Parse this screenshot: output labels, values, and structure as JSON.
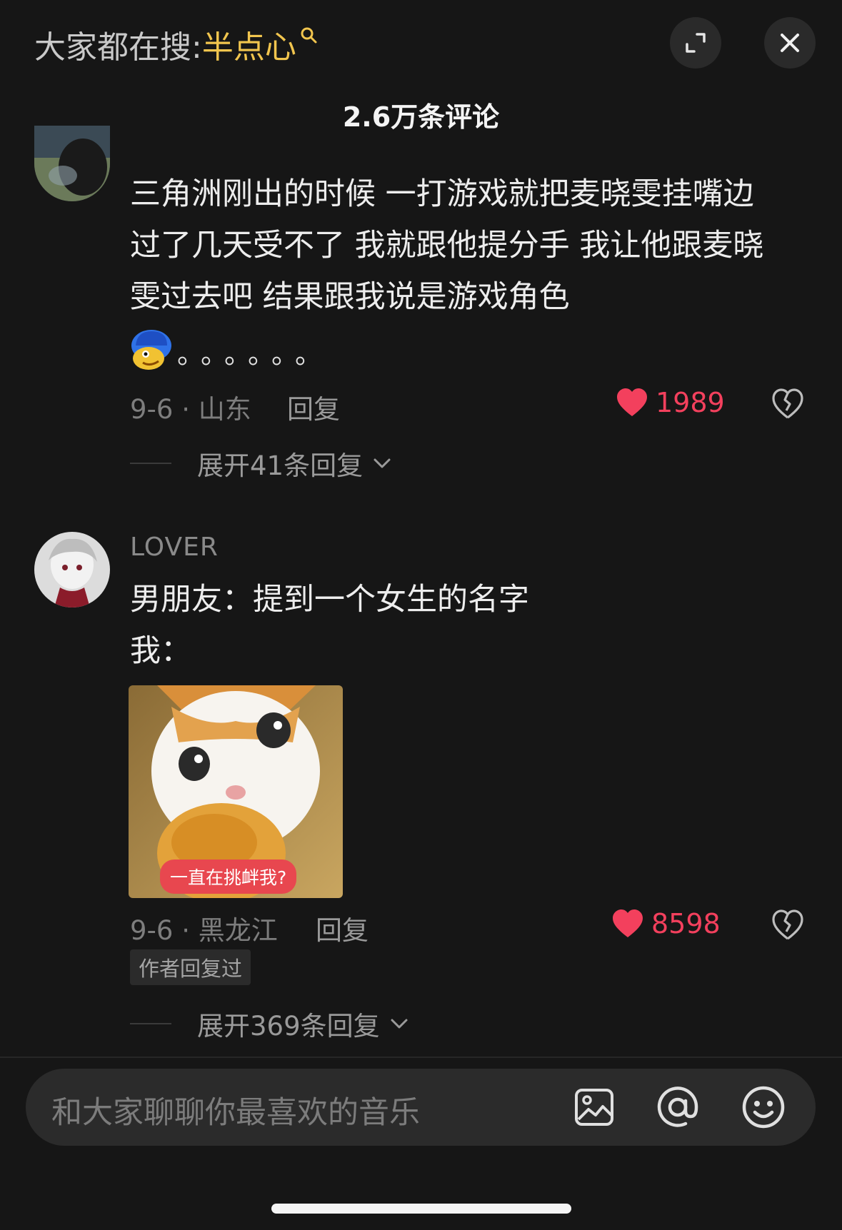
{
  "header": {
    "search_prefix": "大家都在搜:",
    "search_keyword": "半点心",
    "comment_count": "2.6万条评论"
  },
  "comments": [
    {
      "text_line1": "三角洲刚出的时候 一打游戏就把麦晓雯挂嘴边",
      "text_line2": "过了几天受不了 我就跟他提分手 我让他跟麦晓",
      "text_line3": "雯过去吧 结果跟我说是游戏角色",
      "trailing": "。。。。。。",
      "date_location": "9-6 · 山东",
      "reply_label": "回复",
      "likes": "1989",
      "expand_label": "展开41条回复"
    },
    {
      "username": "LOVER",
      "text_line1": "男朋友：提到一个女生的名字",
      "text_line2": "我：",
      "image_caption": "一直在挑衅我?",
      "date_location": "9-6 · 黑龙江",
      "reply_label": "回复",
      "likes": "8598",
      "author_badge": "作者回复过",
      "expand_label": "展开369条回复"
    }
  ],
  "input": {
    "placeholder": "和大家聊聊你最喜欢的音乐"
  },
  "colors": {
    "background": "#161616",
    "accent_keyword": "#f1c54e",
    "like": "#f3405d"
  }
}
